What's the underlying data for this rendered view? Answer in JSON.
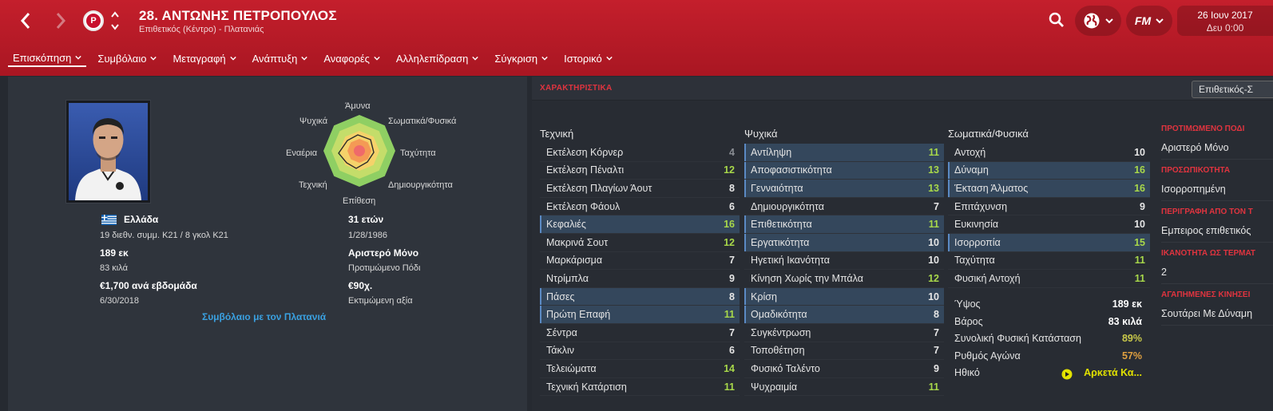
{
  "header": {
    "title": "28. ΑΝΤΩΝΗΣ ΠΕΤΡΟΠΟΥΛΟΣ",
    "subtitle": "Επιθετικός (Κέντρο) - Πλατανιάς",
    "date": "26 Ιουν 2017",
    "time": "Δευ 0:00",
    "fm_label": "FM",
    "club_badge_letter": "P"
  },
  "tabs": [
    {
      "label": "Επισκόπηση",
      "active": true
    },
    {
      "label": "Συμβόλαιο"
    },
    {
      "label": "Μεταγραφή"
    },
    {
      "label": "Ανάπτυξη"
    },
    {
      "label": "Αναφορές"
    },
    {
      "label": "Αλληλεπίδραση"
    },
    {
      "label": "Σύγκριση"
    },
    {
      "label": "Ιστορικό"
    }
  ],
  "profile": {
    "nation": "Ελλάδα",
    "caps": "19 διεθν. συμμ. Κ21 / 8 γκολ Κ21",
    "height": "189 εκ",
    "weight": "83 κιλά",
    "wage": "€1,700 ανά εβδομάδα",
    "contract_end": "6/30/2018",
    "age": "31 ετών",
    "dob": "1/28/1986",
    "foot": "Αριστερό Μόνο",
    "foot_label": "Προτιμώμενο Πόδι",
    "value": "€90χ.",
    "value_label": "Εκτιμώμενη αξία",
    "contract_link": "Συμβόλαιο με τον Πλατανιά"
  },
  "radar": {
    "labels": {
      "top": "Άμυνα",
      "top_right": "Σωματικά/Φυσικά",
      "right": "Ταχύτητα",
      "bottom_right": "Δημιουργικότητα",
      "bottom": "Επίθεση",
      "bottom_left": "Τεχνική",
      "left": "Εναέρια",
      "top_left": "Ψυχικά"
    }
  },
  "attributes": {
    "title": "ΧΑΡΑΚΤΗΡΙΣΤΙΚΑ",
    "role_select": "Επιθετικός-Σ",
    "technical": {
      "heading": "Τεχνική",
      "items": [
        {
          "name": "Εκτέλεση Κόρνερ",
          "value": "4",
          "tone": "grey",
          "hl": false
        },
        {
          "name": "Εκτέλεση Πέναλτι",
          "value": "12",
          "tone": "green",
          "hl": false
        },
        {
          "name": "Εκτέλεση Πλαγίων Άουτ",
          "value": "8",
          "tone": "white",
          "hl": false
        },
        {
          "name": "Εκτέλεση Φάουλ",
          "value": "6",
          "tone": "white",
          "hl": false
        },
        {
          "name": "Κεφαλιές",
          "value": "16",
          "tone": "green",
          "hl": true
        },
        {
          "name": "Μακρινά Σουτ",
          "value": "12",
          "tone": "green",
          "hl": false
        },
        {
          "name": "Μαρκάρισμα",
          "value": "7",
          "tone": "white",
          "hl": false
        },
        {
          "name": "Ντρίμπλα",
          "value": "9",
          "tone": "white",
          "hl": false
        },
        {
          "name": "Πάσες",
          "value": "8",
          "tone": "white",
          "hl": true
        },
        {
          "name": "Πρώτη Επαφή",
          "value": "11",
          "tone": "green",
          "hl": true
        },
        {
          "name": "Σέντρα",
          "value": "7",
          "tone": "white",
          "hl": false
        },
        {
          "name": "Τάκλιν",
          "value": "6",
          "tone": "white",
          "hl": false
        },
        {
          "name": "Τελειώματα",
          "value": "14",
          "tone": "green",
          "hl": false
        },
        {
          "name": "Τεχνική Κατάρτιση",
          "value": "11",
          "tone": "green",
          "hl": false
        }
      ]
    },
    "mental": {
      "heading": "Ψυχικά",
      "items": [
        {
          "name": "Αντίληψη",
          "value": "11",
          "tone": "green",
          "hl": true
        },
        {
          "name": "Αποφασιστικότητα",
          "value": "13",
          "tone": "green",
          "hl": true
        },
        {
          "name": "Γενναιότητα",
          "value": "13",
          "tone": "green",
          "hl": true
        },
        {
          "name": "Δημιουργικότητα",
          "value": "7",
          "tone": "white",
          "hl": false
        },
        {
          "name": "Επιθετικότητα",
          "value": "11",
          "tone": "green",
          "hl": true
        },
        {
          "name": "Εργατικότητα",
          "value": "10",
          "tone": "white",
          "hl": true
        },
        {
          "name": "Ηγετική Ικανότητα",
          "value": "10",
          "tone": "white",
          "hl": false
        },
        {
          "name": "Κίνηση Χωρίς την Μπάλα",
          "value": "12",
          "tone": "green",
          "hl": false
        },
        {
          "name": "Κρίση",
          "value": "10",
          "tone": "white",
          "hl": true
        },
        {
          "name": "Ομαδικότητα",
          "value": "8",
          "tone": "white",
          "hl": true
        },
        {
          "name": "Συγκέντρωση",
          "value": "7",
          "tone": "white",
          "hl": false
        },
        {
          "name": "Τοποθέτηση",
          "value": "7",
          "tone": "white",
          "hl": false
        },
        {
          "name": "Φυσικό Ταλέντο",
          "value": "9",
          "tone": "white",
          "hl": false
        },
        {
          "name": "Ψυχραιμία",
          "value": "11",
          "tone": "green",
          "hl": false
        }
      ]
    },
    "physical": {
      "heading": "Σωματικά/Φυσικά",
      "items": [
        {
          "name": "Αντοχή",
          "value": "10",
          "tone": "white",
          "hl": false
        },
        {
          "name": "Δύναμη",
          "value": "16",
          "tone": "green",
          "hl": true
        },
        {
          "name": "Έκταση Άλματος",
          "value": "16",
          "tone": "green",
          "hl": true
        },
        {
          "name": "Επιτάχυνση",
          "value": "9",
          "tone": "white",
          "hl": false
        },
        {
          "name": "Ευκινησία",
          "value": "10",
          "tone": "white",
          "hl": false
        },
        {
          "name": "Ισορροπία",
          "value": "15",
          "tone": "green",
          "hl": true
        },
        {
          "name": "Ταχύτητα",
          "value": "11",
          "tone": "green",
          "hl": false
        },
        {
          "name": "Φυσική Αντοχή",
          "value": "11",
          "tone": "green",
          "hl": false
        }
      ]
    },
    "physique": [
      {
        "name": "Ύψος",
        "value": "189 εκ",
        "color": "#ffffff"
      },
      {
        "name": "Βάρος",
        "value": "83 κιλά",
        "color": "#ffffff"
      },
      {
        "name": "Συνολική Φυσική Κατάσταση",
        "value": "89%",
        "color": "#c9c94a"
      },
      {
        "name": "Ρυθμός Αγώνα",
        "value": "57%",
        "color": "#e0a040"
      },
      {
        "name": "Ηθικό",
        "value": "Αρκετά Κα...",
        "color": "#e3e300"
      }
    ],
    "side": [
      {
        "heading": "ΠΡΟΤΙΜΩΜΕΝΟ ΠΟΔΙ",
        "value": "Αριστερό Μόνο"
      },
      {
        "heading": "ΠΡΟΣΩΠΙΚΟΤΗΤΑ",
        "value": "Ισορροπημένη"
      },
      {
        "heading": "ΠΕΡΙΓΡΑΦΗ ΑΠΟ ΤΟΝ Τ",
        "value": "Εμπειρος επιθετικός"
      },
      {
        "heading": "ΙΚΑΝΟΤΗΤΑ ΩΣ ΤΕΡΜΑΤ",
        "value": "2"
      },
      {
        "heading": "ΑΓΑΠΗΜΕΝΕΣ ΚΙΝΗΣΕΙ",
        "value": "Σουτάρει Με Δύναμη"
      }
    ]
  },
  "colors": {
    "header_red": "#c41f2c",
    "accent_blue": "#3aa0e0",
    "section_red": "#e0343f",
    "good_green": "#a8d84a"
  }
}
